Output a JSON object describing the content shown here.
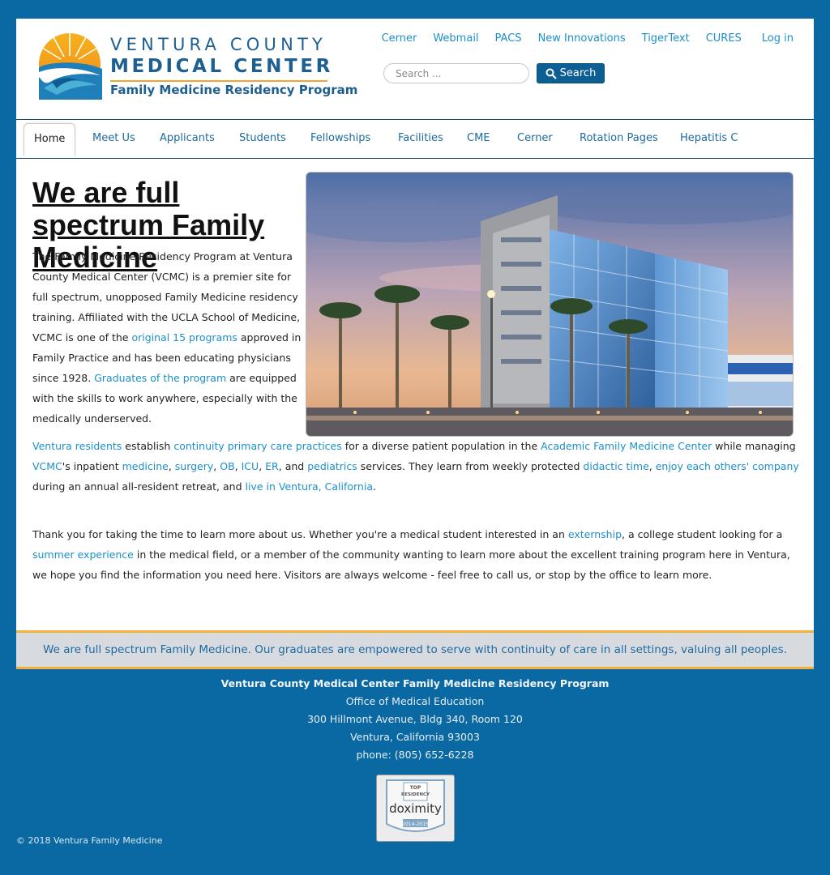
{
  "logo": {
    "line1": "VENTURA COUNTY",
    "line2": "MEDICAL CENTER",
    "line3": "Family Medicine Residency Program"
  },
  "top_links": [
    "Cerner",
    "Webmail",
    "PACS",
    "New Innovations",
    "TigerText",
    "CURES"
  ],
  "login_label": "Log in",
  "search": {
    "placeholder": "Search ...",
    "button_label": "Search"
  },
  "nav": [
    "Home",
    "Meet Us",
    "Applicants",
    "Students",
    "Fellowships",
    "Facilities",
    "CME",
    "Cerner",
    "Rotation Pages",
    "Hepatitis C"
  ],
  "hero": {
    "title": "We are full spectrum Family Medicine",
    "image_alt": "Ventura County Medical Center building"
  },
  "intro": {
    "t1": "The Family Medicine Residency Program at Ventura County Medical Center (VCMC) is a premier site for full spectrum, unopposed Family Medicine residency training. Affiliated with the UCLA School of Medicine, VCMC is one of the ",
    "l1": "original 15 programs",
    "t2": " approved in Family Practice and has been educating physicians since 1928. ",
    "l2": "Graduates of the program",
    "t3": " are equipped with the skills to work anywhere, especially with the medically underserved."
  },
  "para2": {
    "l1": "Ventura residents",
    "t1": " establish ",
    "l2": "continuity primary care practices",
    "t2": " for a diverse patient population in the ",
    "l3": "Academic Family Medicine Center",
    "t3": " while managing ",
    "l4": "VCMC",
    "t4": "'s inpatient ",
    "l5": "medicine",
    "s1": ", ",
    "l6": "surgery",
    "s2": ", ",
    "l7": "OB",
    "s3": ", ",
    "l8": "ICU",
    "s4": ", ",
    "l9": "ER",
    "t5": ", and ",
    "l10": "pediatrics",
    "t6": " services. They learn from weekly protected ",
    "l11": "didactic time",
    "s5": ", ",
    "l12": "enjoy each others' company",
    "t7": " during an annual all-resident retreat, and ",
    "l13": "live in Ventura, California",
    "t8": "."
  },
  "para3": {
    "t1": "Thank you for taking the time to learn more about us.  Whether you're a medical student interested in an ",
    "l1": "externship",
    "t2": ", a college student looking for a ",
    "l2": "summer experience",
    "t3": " in the medical field, or a member of the community wanting to learn more about the excellent training program here in Ventura, we hope you find the information you need here.  Visitors are always welcome - feel free to call us, or stop by the office to learn more."
  },
  "banner": "We are full spectrum Family Medicine. Our graduates are empowered to serve with continuity of care in all settings, valuing all peoples.",
  "footer": {
    "title": "Ventura County Medical Center Family Medicine Residency Program",
    "line1": "Office of Medical Education",
    "line2": "300 Hillmont Avenue, Bldg 340, Room 120",
    "line3": "Ventura, California 93003",
    "line4": "phone: (805) 652-6228",
    "copyright": "© 2018 Ventura Family Medicine"
  },
  "badge": {
    "top": "TOP",
    "residency": "RESIDENCY",
    "brand": "doximity",
    "years": "2014-2015"
  },
  "colors": {
    "page_bg": "#0a69a3",
    "link": "#1c8fc9",
    "accent": "#f2b13a",
    "logo_blue": "#1e5f92"
  },
  "icons": {
    "search_button": "search-icon"
  }
}
